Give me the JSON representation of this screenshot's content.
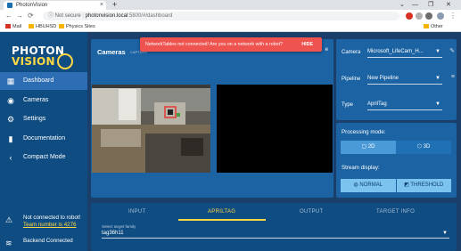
{
  "browser": {
    "tab_title": "PhotonVision",
    "tab_close": "×",
    "new_tab": "+",
    "window_controls": [
      "⌄",
      "—",
      "❐",
      "✕"
    ],
    "nav": [
      "←",
      "→",
      "⟳"
    ],
    "security": "ⓘ Not secure",
    "url_host": "photonvision.local",
    "url_path": ":5800/#/dashboard",
    "bookmarks": [
      {
        "label": "Mail",
        "color": "#d93025"
      },
      {
        "label": "HBUHSD",
        "color": "#f4b400"
      },
      {
        "label": "Physics Sites",
        "color": "#f4b400"
      }
    ],
    "other_bookmarks": "Other bookmarks"
  },
  "logo": {
    "top": "PHOTON",
    "bottom": "VISION"
  },
  "sidebar": {
    "items": [
      {
        "label": "Dashboard",
        "icon": "dashboard-icon",
        "glyph": "▦"
      },
      {
        "label": "Cameras",
        "icon": "camera-icon",
        "glyph": "◉"
      },
      {
        "label": "Settings",
        "icon": "gear-icon",
        "glyph": "⚙"
      },
      {
        "label": "Documentation",
        "icon": "book-icon",
        "glyph": "▮"
      },
      {
        "label": "Compact Mode",
        "icon": "chevron-left-icon",
        "glyph": "‹"
      }
    ],
    "status": {
      "robot_text": "Not connected to robot!",
      "team_link": "Team number is 4276",
      "backend_text": "Backend Connected"
    }
  },
  "cameras": {
    "title": "Cameras",
    "subtitle": "CAPTURE",
    "right_text": "e"
  },
  "toast": {
    "message": "NetworkTables not connected! Are you on a network with a robot?",
    "action": "HIDE"
  },
  "camera_settings": {
    "camera_label": "Camera",
    "camera_value": "Microsoft_LifeCam_H...",
    "pipeline_label": "Pipeline",
    "pipeline_value": "New Pipeline",
    "type_label": "Type",
    "type_value": "AprilTag"
  },
  "processing": {
    "mode_label": "Processing mode:",
    "mode_2d": "2D",
    "mode_3d": "3D",
    "stream_label": "Stream display:",
    "normal": "NORMAL",
    "threshold": "THRESHOLD"
  },
  "pipeline_tabs": {
    "tabs": [
      "INPUT",
      "APRILTAG",
      "OUTPUT",
      "TARGET INFO"
    ],
    "active": "APRILTAG",
    "target_family_label": "Select target family",
    "target_family_value": "tag36h11"
  },
  "colors": {
    "accent_yellow": "#ffd843",
    "sidebar_blue": "#0f4c81",
    "card_blue": "#1b63a3",
    "toast_red": "#ef5350"
  }
}
